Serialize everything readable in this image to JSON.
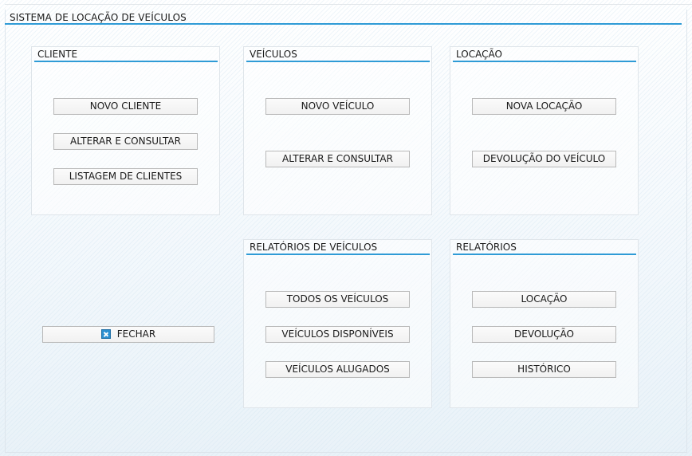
{
  "window": {
    "title": "SISTEMA DE LOCAÇÃO DE VEÍCULOS"
  },
  "panels": {
    "cliente": {
      "title": "CLIENTE",
      "buttons": [
        "NOVO CLIENTE",
        "ALTERAR E CONSULTAR",
        "LISTAGEM DE CLIENTES"
      ]
    },
    "veiculos": {
      "title": "VEÍCULOS",
      "buttons": [
        "NOVO VEÍCULO",
        "ALTERAR E CONSULTAR"
      ]
    },
    "locacao": {
      "title": "LOCAÇÃO",
      "buttons": [
        "NOVA LOCAÇÃO",
        "DEVOLUÇÃO DO VEÍCULO"
      ]
    },
    "relatorios_veiculos": {
      "title": "RELATÓRIOS DE VEÍCULOS",
      "buttons": [
        "TODOS OS VEÍCULOS",
        "VEÍCULOS DISPONÍVEIS",
        "VEÍCULOS ALUGADOS"
      ]
    },
    "relatorios": {
      "title": "RELATÓRIOS",
      "buttons": [
        "LOCAÇÃO",
        "DEVOLUÇÃO",
        "HISTÓRICO"
      ]
    }
  },
  "close_button": {
    "label": "FECHAR",
    "icon": "close-icon"
  },
  "colors": {
    "accent": "#2f9bd6",
    "icon_blue": "#2a8fd0"
  }
}
